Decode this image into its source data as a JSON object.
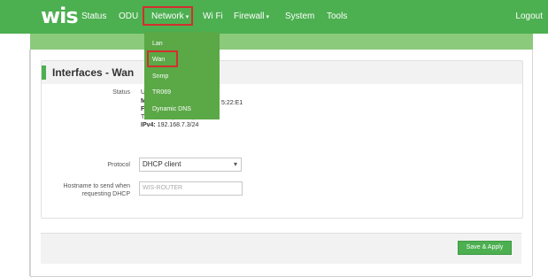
{
  "logo": "wis",
  "nav": {
    "status": "Status",
    "odu": "ODU",
    "network": "Network",
    "wifi": "Wi Fi",
    "firewall": "Firewall",
    "system": "System",
    "tools": "Tools",
    "logout": "Logout",
    "caret": "▾"
  },
  "network_menu": {
    "items": [
      "Lan",
      "Wan",
      "Snmp",
      "TR069",
      "Dynamic DNS"
    ],
    "selected": "Wan"
  },
  "panel": {
    "title": "Interfaces - Wan",
    "status_label": "Status",
    "status_lines": {
      "line1": "U",
      "line2_prefix": "M",
      "line2_suffix": "5:22:E1",
      "line3": "F",
      "tx": "TX: 0.00 B (0 Pkts.)",
      "ipv4_label": "IPv4:",
      "ipv4_value": "192.168.7.3/24"
    },
    "protocol_label": "Protocol",
    "protocol_value": "DHCP client",
    "hostname_label_1": "Hostname to send when",
    "hostname_label_2": "requesting DHCP",
    "hostname_placeholder": "WIS-ROUTER"
  },
  "footer": {
    "save_apply": "Save & Apply"
  },
  "colors": {
    "brand_green": "#4caf50",
    "highlight_red": "#d32f2f"
  }
}
